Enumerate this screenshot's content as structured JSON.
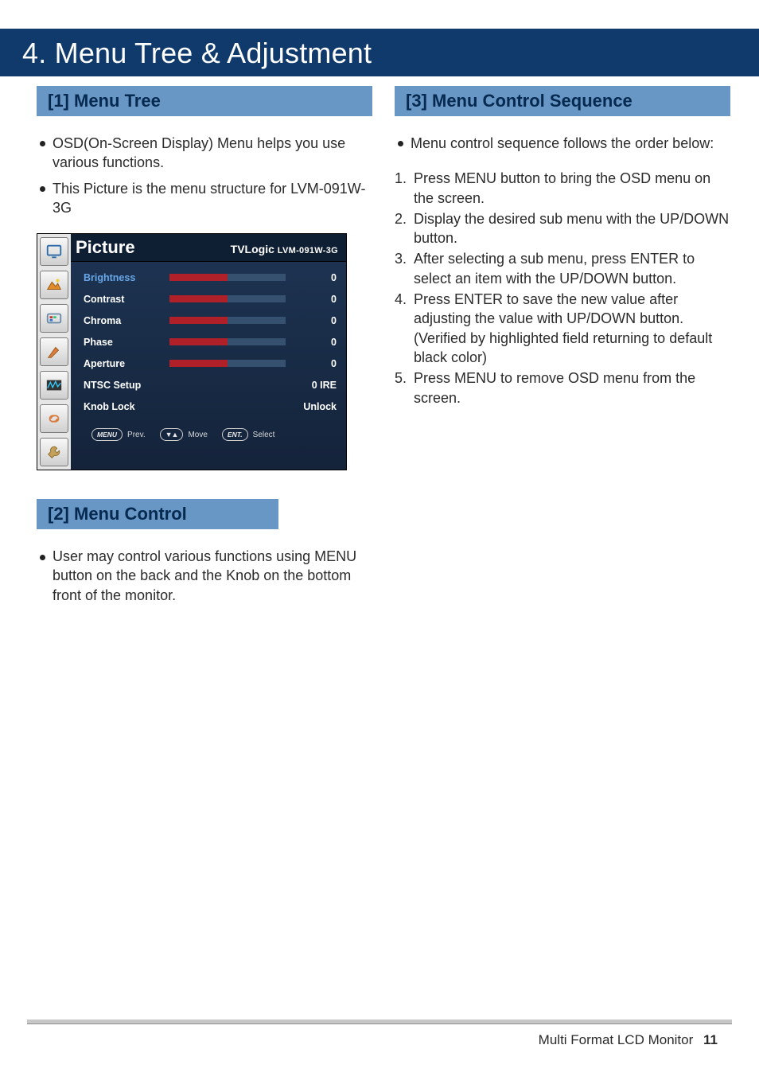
{
  "page_title": "4. Menu Tree & Adjustment",
  "footer": {
    "label": "Multi Format LCD Monitor",
    "page": "11"
  },
  "left": {
    "sec1": {
      "heading": "[1] Menu Tree",
      "bullets": [
        "OSD(On-Screen Display) Menu helps you use various functions.",
        "This Picture is the menu structure for LVM-091W-3G"
      ]
    },
    "osd": {
      "category": "Picture",
      "brand": "TVLogic",
      "model": "LVM-091W-3G",
      "items": [
        {
          "label": "Brightness",
          "value": "0",
          "gauge": 0.5,
          "highlight": true
        },
        {
          "label": "Contrast",
          "value": "0",
          "gauge": 0.5
        },
        {
          "label": "Chroma",
          "value": "0",
          "gauge": 0.5
        },
        {
          "label": "Phase",
          "value": "0",
          "gauge": 0.5
        },
        {
          "label": "Aperture",
          "value": "0",
          "gauge": 0.5
        },
        {
          "label": "NTSC Setup",
          "value": "0 IRE"
        },
        {
          "label": "Knob Lock",
          "value": "Unlock"
        }
      ],
      "hints": [
        {
          "btn": "MENU",
          "text": "Prev."
        },
        {
          "btn": "▼▲",
          "text": "Move"
        },
        {
          "btn": "ENT.",
          "text": "Select"
        }
      ]
    },
    "sec2": {
      "heading": "[2] Menu Control",
      "bullets": [
        "User may control various functions using MENU button on the back and the Knob on the bottom front of the monitor."
      ]
    }
  },
  "right": {
    "sec1": {
      "heading": "[3] Menu Control Sequence",
      "bullets": [
        "Menu control sequence follows the order below:"
      ],
      "steps": [
        "Press MENU button to bring the OSD menu on the screen.",
        "Display the desired sub menu with the UP/DOWN button.",
        " After selecting a sub menu, press ENTER to select an item with the UP/DOWN button.",
        "Press ENTER to save the new value after adjusting the value with UP/DOWN button. (Verified by highlighted field returning to default black color)",
        "Press MENU to remove OSD menu from the screen."
      ]
    }
  }
}
